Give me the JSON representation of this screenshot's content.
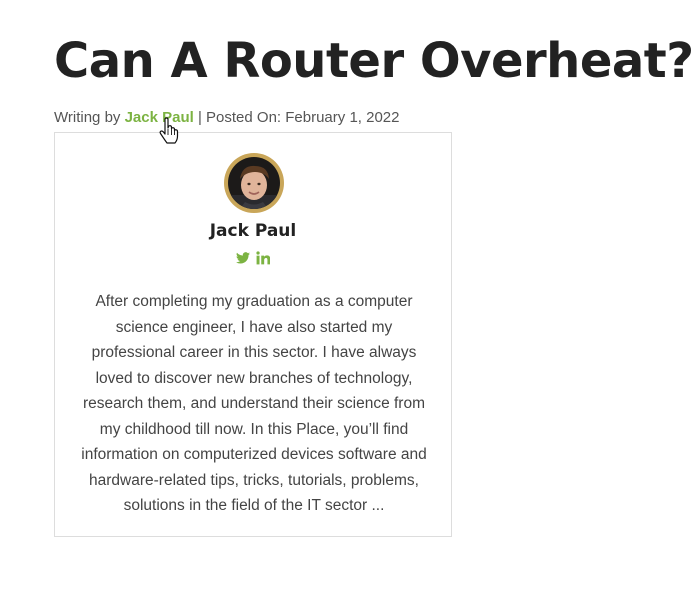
{
  "post": {
    "title": "Can A Router Overheat?",
    "meta": {
      "prefix": "Writing by ",
      "author": "Jack Paul",
      "separator": " | ",
      "posted_label": "Posted On: ",
      "date": "February 1, 2022"
    }
  },
  "author_box": {
    "name": "Jack Paul",
    "social": [
      {
        "icon": "twitter-icon",
        "color": "#7cb342"
      },
      {
        "icon": "linkedin-icon",
        "color": "#7cb342"
      }
    ],
    "bio": "After completing my graduation as a computer science engineer, I have also started my professional career in this sector. I have always loved to discover new branches of technology, research them, and understand their science from my childhood till now. In this Place, you’ll find information on computerized devices software and hardware-related tips, tricks, tutorials, problems, solutions in the field of the IT sector ...",
    "avatar_border_color": "#c9a659"
  },
  "colors": {
    "accent": "#7cb342",
    "text": "#222222",
    "muted": "#555555",
    "card_border": "#dddddd"
  },
  "cursor": {
    "icon": "hand-pointer-icon"
  }
}
